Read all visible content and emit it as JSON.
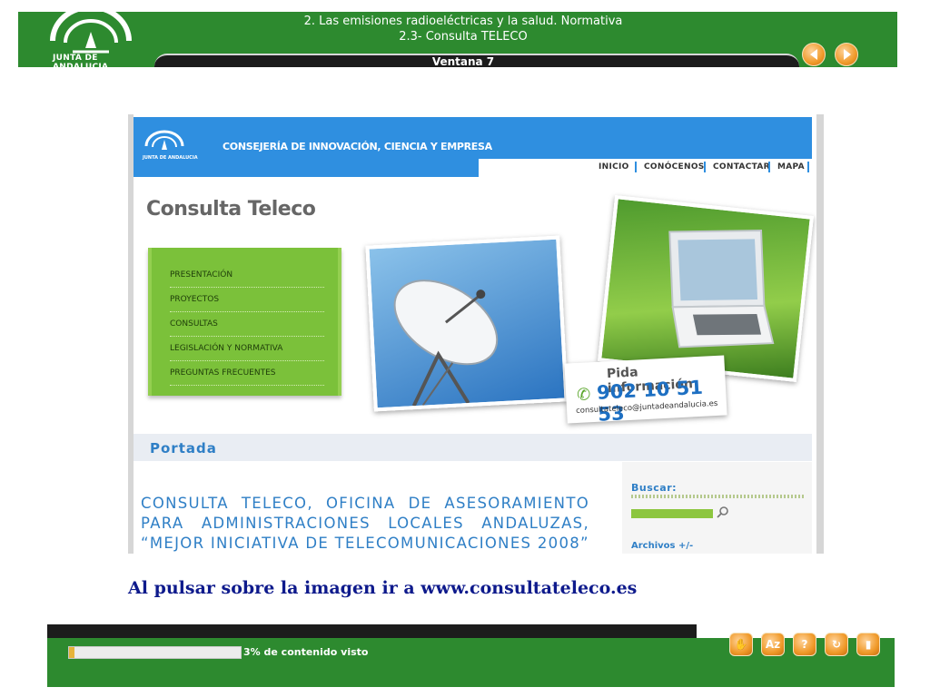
{
  "header": {
    "title_line1": "2. Las emisiones radioeléctricas y la salud. Normativa",
    "title_line2": "2.3- Consulta TELECO",
    "window_label": "Ventana 7",
    "logo_text": "JUNTA DE ANDALUCIA",
    "colors": {
      "bar": "#2d8a2f",
      "tab": "#1c1c1c",
      "nav_button": "#f09a2a"
    },
    "nav": {
      "prev_icon": "arrow-left-icon",
      "next_icon": "arrow-right-icon"
    }
  },
  "website": {
    "logo_text": "JUNTA DE ANDALUCIA",
    "org": "CONSEJERÍA DE INNOVACIÓN, CIENCIA Y EMPRESA",
    "nav": [
      "INICIO",
      "CONÓCENOS",
      "CONTACTAR",
      "MAPA"
    ],
    "page_title": "Consulta Teleco",
    "menu": [
      "PRESENTACIÓN",
      "PROYECTOS",
      "CONSULTAS",
      "LEGISLACIÓN Y NORMATIVA",
      "PREGUNTAS FRECUENTES"
    ],
    "info": {
      "title": "Pida información",
      "phone": "902 10 51 53",
      "email": "consultateleco@juntadeandalucia.es"
    },
    "section": "Portada",
    "headline": "CONSULTA TELECO, OFICINA DE ASESORAMIENTO PARA ADMINISTRACIONES LOCALES ANDALUZAS, “MEJOR INICIATIVA DE TELECOMUNICACIONES 2008”",
    "sidebar": {
      "search_label": "Buscar:",
      "archive_label": "Archivos +/-"
    },
    "colors": {
      "header": "#2f8fe0",
      "menu": "#7bc13a",
      "text": "#2f7fc6"
    }
  },
  "caption": "Al pulsar sobre la imagen ir a www.consultateleco.es",
  "footer": {
    "progress_percent": 3,
    "progress_text": "3% de contenido visto",
    "tools": [
      {
        "icon": "hand-icon",
        "glyph": "✋"
      },
      {
        "icon": "glossary-az-icon",
        "glyph": "Az"
      },
      {
        "icon": "help-icon",
        "glyph": "?"
      },
      {
        "icon": "refresh-icon",
        "glyph": "↻"
      },
      {
        "icon": "exit-door-icon",
        "glyph": "▮"
      }
    ]
  }
}
